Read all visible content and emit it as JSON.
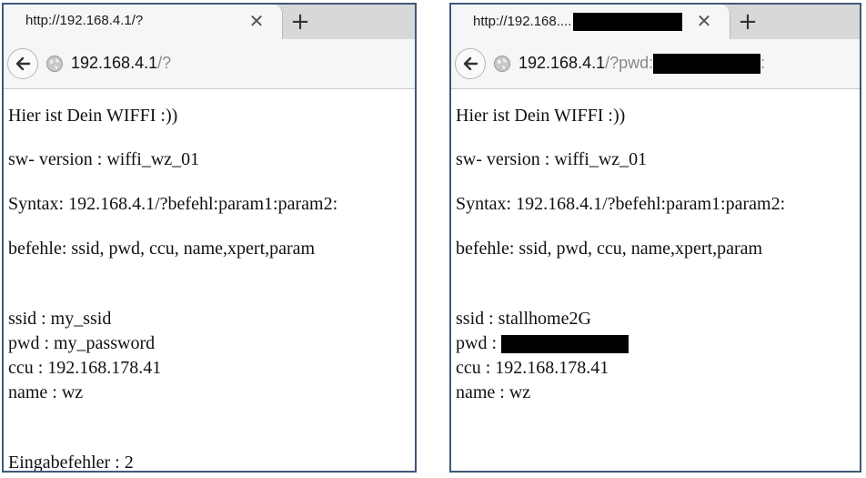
{
  "left": {
    "tab_title": "http://192.168.4.1/?",
    "tab_close": "✕",
    "new_tab": "+",
    "url_host": "192.168.4.1",
    "url_rest": "/?",
    "lines": {
      "greeting": "Hier ist Dein WIFFI :))",
      "version": "sw- version : wiffi_wz_01",
      "syntax": "Syntax: 192.168.4.1/?befehl:param1:param2:",
      "commands": "befehle: ssid, pwd, ccu, name,xpert,param",
      "ssid": "ssid : my_ssid",
      "pwd": "pwd : my_password",
      "ccu": "ccu : 192.168.178.41",
      "name": "name : wz",
      "error": "Eingabefehler : 2"
    }
  },
  "right": {
    "tab_title": "http://192.168....",
    "tab_close": "✕",
    "new_tab": "+",
    "url_host": "192.168.4.1",
    "url_rest": "/?pwd:",
    "url_tail": ":",
    "lines": {
      "greeting": "Hier ist Dein WIFFI :))",
      "version": "sw- version : wiffi_wz_01",
      "syntax": "Syntax: 192.168.4.1/?befehl:param1:param2:",
      "commands": "befehle: ssid, pwd, ccu, name,xpert,param",
      "ssid": "ssid : stallhome2G",
      "pwd_label": "pwd :",
      "ccu": "ccu : 192.168.178.41",
      "name": "name : wz"
    }
  },
  "icons": {
    "back": "back-arrow-icon",
    "globe": "globe-icon",
    "close": "close-icon",
    "plus": "plus-icon"
  },
  "colors": {
    "panel_border": "#41577a",
    "tabstrip_bg": "#d8d8d8",
    "toolbar_bg": "#f5f6f7"
  }
}
